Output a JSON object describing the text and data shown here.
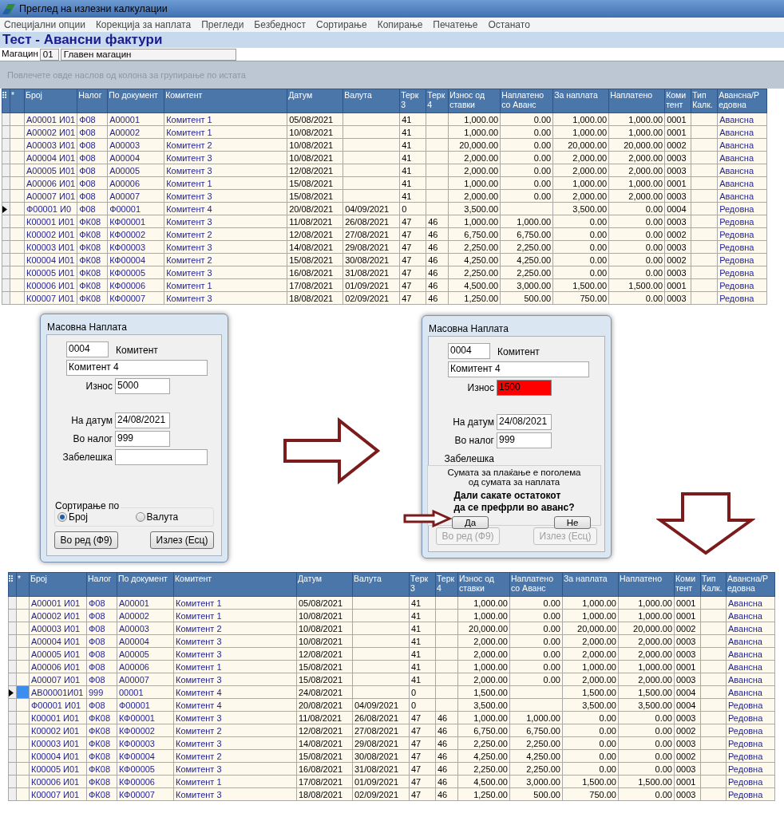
{
  "window": {
    "title": "Преглед на излезни калкулации"
  },
  "menu": [
    "Специјални опции",
    "Корекција за наплата",
    "Прегледи",
    "Безбедност",
    "Сортирање",
    "Копирање",
    "Печатење",
    "Останато"
  ],
  "heading": "Тест - Авансни фактури",
  "warehouse": {
    "label": "Магацин",
    "code": "01",
    "name": "Главен магацин"
  },
  "group_panel": {
    "hint": "Повлечете овде наслов од колона за групирање по истата"
  },
  "grids": [
    {
      "marker_header": "*",
      "current_cell_highlighted": false,
      "columns": [
        {
          "lines": [
            "Број"
          ],
          "kind": "text"
        },
        {
          "lines": [
            "Налог"
          ],
          "kind": "text"
        },
        {
          "lines": [
            "По документ"
          ],
          "kind": "text"
        },
        {
          "lines": [
            "Комитент"
          ],
          "kind": "text"
        },
        {
          "lines": [
            "Датум"
          ],
          "kind": "plain"
        },
        {
          "lines": [
            "Валута"
          ],
          "kind": "plain"
        },
        {
          "lines": [
            "Терк",
            "3"
          ],
          "kind": "plain"
        },
        {
          "lines": [
            "Терк",
            "4"
          ],
          "kind": "plain"
        },
        {
          "lines": [
            "Износ од",
            "ставки"
          ],
          "kind": "number"
        },
        {
          "lines": [
            "Наплатено",
            "со Аванс"
          ],
          "kind": "number"
        },
        {
          "lines": [
            "За наплата"
          ],
          "kind": "number"
        },
        {
          "lines": [
            "Наплатено"
          ],
          "kind": "number"
        },
        {
          "lines": [
            "Коми",
            "тент"
          ],
          "kind": "plain"
        },
        {
          "lines": [
            "Тип",
            "Калк."
          ],
          "kind": "plain"
        },
        {
          "lines": [
            "Авансна/Р",
            "едовна"
          ],
          "kind": "text"
        }
      ],
      "rows": [
        {
          "selected": false,
          "cells": [
            "А00001 И01",
            "Ф08",
            "А00001",
            "Комитент 1",
            "05/08/2021",
            null,
            "41",
            null,
            "1,000.00",
            "0.00",
            "1,000.00",
            "1,000.00",
            "0001",
            null,
            "Авансна"
          ]
        },
        {
          "selected": false,
          "cells": [
            "А00002 И01",
            "Ф08",
            "А00002",
            "Комитент 1",
            "10/08/2021",
            null,
            "41",
            null,
            "1,000.00",
            "0.00",
            "1,000.00",
            "1,000.00",
            "0001",
            null,
            "Авансна"
          ]
        },
        {
          "selected": false,
          "cells": [
            "А00003 И01",
            "Ф08",
            "А00003",
            "Комитент 2",
            "10/08/2021",
            null,
            "41",
            null,
            "20,000.00",
            "0.00",
            "20,000.00",
            "20,000.00",
            "0002",
            null,
            "Авансна"
          ]
        },
        {
          "selected": false,
          "cells": [
            "А00004 И01",
            "Ф08",
            "А00004",
            "Комитент 3",
            "10/08/2021",
            null,
            "41",
            null,
            "2,000.00",
            "0.00",
            "2,000.00",
            "2,000.00",
            "0003",
            null,
            "Авансна"
          ]
        },
        {
          "selected": false,
          "cells": [
            "А00005 И01",
            "Ф08",
            "А00005",
            "Комитент 3",
            "12/08/2021",
            null,
            "41",
            null,
            "2,000.00",
            "0.00",
            "2,000.00",
            "2,000.00",
            "0003",
            null,
            "Авансна"
          ]
        },
        {
          "selected": false,
          "cells": [
            "А00006 И01",
            "Ф08",
            "А00006",
            "Комитент 1",
            "15/08/2021",
            null,
            "41",
            null,
            "1,000.00",
            "0.00",
            "1,000.00",
            "1,000.00",
            "0001",
            null,
            "Авансна"
          ]
        },
        {
          "selected": false,
          "cells": [
            "А00007 И01",
            "Ф08",
            "А00007",
            "Комитент 3",
            "15/08/2021",
            null,
            "41",
            null,
            "2,000.00",
            "0.00",
            "2,000.00",
            "2,000.00",
            "0003",
            null,
            "Авансна"
          ]
        },
        {
          "selected": true,
          "cells": [
            "Ф00001 И0",
            "Ф08",
            "Ф00001",
            "Комитент 4",
            "20/08/2021",
            "04/09/2021",
            "0",
            null,
            "3,500.00",
            null,
            "3,500.00",
            "0.00",
            "0004",
            null,
            "Редовна"
          ]
        },
        {
          "selected": false,
          "cells": [
            "К00001 И01",
            "ФК08",
            "КФ00001",
            "Комитент 3",
            "11/08/2021",
            "26/08/2021",
            "47",
            "46",
            "1,000.00",
            "1,000.00",
            "0.00",
            "0.00",
            "0003",
            null,
            "Редовна"
          ]
        },
        {
          "selected": false,
          "cells": [
            "К00002 И01",
            "ФК08",
            "КФ00002",
            "Комитент 2",
            "12/08/2021",
            "27/08/2021",
            "47",
            "46",
            "6,750.00",
            "6,750.00",
            "0.00",
            "0.00",
            "0002",
            null,
            "Редовна"
          ]
        },
        {
          "selected": false,
          "cells": [
            "К00003 И01",
            "ФК08",
            "КФ00003",
            "Комитент 3",
            "14/08/2021",
            "29/08/2021",
            "47",
            "46",
            "2,250.00",
            "2,250.00",
            "0.00",
            "0.00",
            "0003",
            null,
            "Редовна"
          ]
        },
        {
          "selected": false,
          "cells": [
            "К00004 И01",
            "ФК08",
            "КФ00004",
            "Комитент 2",
            "15/08/2021",
            "30/08/2021",
            "47",
            "46",
            "4,250.00",
            "4,250.00",
            "0.00",
            "0.00",
            "0002",
            null,
            "Редовна"
          ]
        },
        {
          "selected": false,
          "cells": [
            "К00005 И01",
            "ФК08",
            "КФ00005",
            "Комитент 3",
            "16/08/2021",
            "31/08/2021",
            "47",
            "46",
            "2,250.00",
            "2,250.00",
            "0.00",
            "0.00",
            "0003",
            null,
            "Редовна"
          ]
        },
        {
          "selected": false,
          "cells": [
            "К00006 И01",
            "ФК08",
            "КФ00006",
            "Комитент 1",
            "17/08/2021",
            "01/09/2021",
            "47",
            "46",
            "4,500.00",
            "3,000.00",
            "1,500.00",
            "1,500.00",
            "0001",
            null,
            "Редовна"
          ]
        },
        {
          "selected": false,
          "cells": [
            "К00007 И01",
            "ФК08",
            "КФ00007",
            "Комитент 3",
            "18/08/2021",
            "02/09/2021",
            "47",
            "46",
            "1,250.00",
            "500.00",
            "750.00",
            "0.00",
            "0003",
            null,
            "Редовна"
          ]
        }
      ]
    },
    {
      "marker_header": "*",
      "current_cell_highlighted": true,
      "columns": [
        {
          "lines": [
            "Број"
          ],
          "kind": "text"
        },
        {
          "lines": [
            "Налог"
          ],
          "kind": "text"
        },
        {
          "lines": [
            "По документ"
          ],
          "kind": "text"
        },
        {
          "lines": [
            "Комитент"
          ],
          "kind": "text"
        },
        {
          "lines": [
            "Датум"
          ],
          "kind": "plain"
        },
        {
          "lines": [
            "Валута"
          ],
          "kind": "plain"
        },
        {
          "lines": [
            "Терк",
            "3"
          ],
          "kind": "plain"
        },
        {
          "lines": [
            "Терк",
            "4"
          ],
          "kind": "plain"
        },
        {
          "lines": [
            "Износ од",
            "ставки"
          ],
          "kind": "number"
        },
        {
          "lines": [
            "Наплатено",
            "со Аванс"
          ],
          "kind": "number"
        },
        {
          "lines": [
            "За наплата"
          ],
          "kind": "number"
        },
        {
          "lines": [
            "Наплатено"
          ],
          "kind": "number"
        },
        {
          "lines": [
            "Коми",
            "тент"
          ],
          "kind": "plain"
        },
        {
          "lines": [
            "Тип",
            "Калк."
          ],
          "kind": "plain"
        },
        {
          "lines": [
            "Авансна/Р",
            "едовна"
          ],
          "kind": "text"
        }
      ],
      "rows": [
        {
          "selected": false,
          "cells": [
            "А00001 И01",
            "Ф08",
            "А00001",
            "Комитент 1",
            "05/08/2021",
            null,
            "41",
            null,
            "1,000.00",
            "0.00",
            "1,000.00",
            "1,000.00",
            "0001",
            null,
            "Авансна"
          ]
        },
        {
          "selected": false,
          "cells": [
            "А00002 И01",
            "Ф08",
            "А00002",
            "Комитент 1",
            "10/08/2021",
            null,
            "41",
            null,
            "1,000.00",
            "0.00",
            "1,000.00",
            "1,000.00",
            "0001",
            null,
            "Авансна"
          ]
        },
        {
          "selected": false,
          "cells": [
            "А00003 И01",
            "Ф08",
            "А00003",
            "Комитент 2",
            "10/08/2021",
            null,
            "41",
            null,
            "20,000.00",
            "0.00",
            "20,000.00",
            "20,000.00",
            "0002",
            null,
            "Авансна"
          ]
        },
        {
          "selected": false,
          "cells": [
            "А00004 И01",
            "Ф08",
            "А00004",
            "Комитент 3",
            "10/08/2021",
            null,
            "41",
            null,
            "2,000.00",
            "0.00",
            "2,000.00",
            "2,000.00",
            "0003",
            null,
            "Авансна"
          ]
        },
        {
          "selected": false,
          "cells": [
            "А00005 И01",
            "Ф08",
            "А00005",
            "Комитент 3",
            "12/08/2021",
            null,
            "41",
            null,
            "2,000.00",
            "0.00",
            "2,000.00",
            "2,000.00",
            "0003",
            null,
            "Авансна"
          ]
        },
        {
          "selected": false,
          "cells": [
            "А00006 И01",
            "Ф08",
            "А00006",
            "Комитент 1",
            "15/08/2021",
            null,
            "41",
            null,
            "1,000.00",
            "0.00",
            "1,000.00",
            "1,000.00",
            "0001",
            null,
            "Авансна"
          ]
        },
        {
          "selected": false,
          "cells": [
            "А00007 И01",
            "Ф08",
            "А00007",
            "Комитент 3",
            "15/08/2021",
            null,
            "41",
            null,
            "2,000.00",
            "0.00",
            "2,000.00",
            "2,000.00",
            "0003",
            null,
            "Авансна"
          ]
        },
        {
          "selected": true,
          "cells": [
            "АВ00001И01",
            "999",
            "00001",
            "Комитент 4",
            "24/08/2021",
            null,
            "0",
            null,
            "1,500.00",
            null,
            "1,500.00",
            "1,500.00",
            "0004",
            null,
            "Авансна"
          ]
        },
        {
          "selected": false,
          "cells": [
            "Ф00001 И01",
            "Ф08",
            "Ф00001",
            "Комитент 4",
            "20/08/2021",
            "04/09/2021",
            "0",
            null,
            "3,500.00",
            null,
            "3,500.00",
            "3,500.00",
            "0004",
            null,
            "Редовна"
          ]
        },
        {
          "selected": false,
          "cells": [
            "К00001 И01",
            "ФК08",
            "КФ00001",
            "Комитент 3",
            "11/08/2021",
            "26/08/2021",
            "47",
            "46",
            "1,000.00",
            "1,000.00",
            "0.00",
            "0.00",
            "0003",
            null,
            "Редовна"
          ]
        },
        {
          "selected": false,
          "cells": [
            "К00002 И01",
            "ФК08",
            "КФ00002",
            "Комитент 2",
            "12/08/2021",
            "27/08/2021",
            "47",
            "46",
            "6,750.00",
            "6,750.00",
            "0.00",
            "0.00",
            "0002",
            null,
            "Редовна"
          ]
        },
        {
          "selected": false,
          "cells": [
            "К00003 И01",
            "ФК08",
            "КФ00003",
            "Комитент 3",
            "14/08/2021",
            "29/08/2021",
            "47",
            "46",
            "2,250.00",
            "2,250.00",
            "0.00",
            "0.00",
            "0003",
            null,
            "Редовна"
          ]
        },
        {
          "selected": false,
          "cells": [
            "К00004 И01",
            "ФК08",
            "КФ00004",
            "Комитент 2",
            "15/08/2021",
            "30/08/2021",
            "47",
            "46",
            "4,250.00",
            "4,250.00",
            "0.00",
            "0.00",
            "0002",
            null,
            "Редовна"
          ]
        },
        {
          "selected": false,
          "cells": [
            "К00005 И01",
            "ФК08",
            "КФ00005",
            "Комитент 3",
            "16/08/2021",
            "31/08/2021",
            "47",
            "46",
            "2,250.00",
            "2,250.00",
            "0.00",
            "0.00",
            "0003",
            null,
            "Редовна"
          ]
        },
        {
          "selected": false,
          "cells": [
            "К00006 И01",
            "ФК08",
            "КФ00006",
            "Комитент 1",
            "17/08/2021",
            "01/09/2021",
            "47",
            "46",
            "4,500.00",
            "3,000.00",
            "1,500.00",
            "1,500.00",
            "0001",
            null,
            "Редовна"
          ]
        },
        {
          "selected": false,
          "cells": [
            "К00007 И01",
            "ФК08",
            "КФ00007",
            "Комитент 3",
            "18/08/2021",
            "02/09/2021",
            "47",
            "46",
            "1,250.00",
            "500.00",
            "750.00",
            "0.00",
            "0003",
            null,
            "Редовна"
          ]
        }
      ]
    }
  ],
  "dialogs": [
    {
      "title": "Масовна Наплата",
      "partner_code": "0004",
      "partner_label": "Комитент",
      "partner_name": "Комитент 4",
      "fields": [
        {
          "kind": "input",
          "label": "Износ",
          "value": "5000",
          "alert": false
        },
        {
          "kind": "input",
          "label": "На датум",
          "value": "24/08/2021",
          "alert": false
        },
        {
          "kind": "input",
          "label": "Во налог",
          "value": "999",
          "alert": false
        },
        {
          "kind": "input",
          "label": "Забелешка",
          "alert": false
        }
      ],
      "sort_group": {
        "title": "Сортирање по",
        "options": [
          {
            "label": "Број",
            "selected": true
          },
          {
            "label": "Валута",
            "selected": false
          }
        ]
      },
      "buttons": [
        {
          "label": "Во ред (Ф9)",
          "disabled": false
        },
        {
          "label": "Излез (Есц)",
          "disabled": false
        }
      ]
    },
    {
      "title": "Масовна Наплата",
      "partner_code": "0004",
      "partner_label": "Комитент",
      "partner_name": "Комитент 4",
      "fields": [
        {
          "kind": "input",
          "label": "Износ",
          "value": "1500",
          "alert": true
        },
        {
          "kind": "input",
          "label": "На датум",
          "value": "24/08/2021",
          "alert": false
        },
        {
          "kind": "input",
          "label": "Во налог",
          "value": "999",
          "alert": false
        },
        {
          "kind": "label_only",
          "label": "Забелешка"
        }
      ],
      "message": {
        "lines": [
          "Сумата за плаќање е поголема",
          "од сумата за наплата"
        ],
        "question": [
          "Дали сакате остатокот",
          "да се префрли во аванс?"
        ],
        "buttons": [
          "Да",
          "Не"
        ]
      },
      "buttons": [
        {
          "label": "Во ред (Ф9)",
          "disabled": true
        },
        {
          "label": "Излез (Есц)",
          "disabled": true
        }
      ]
    }
  ]
}
